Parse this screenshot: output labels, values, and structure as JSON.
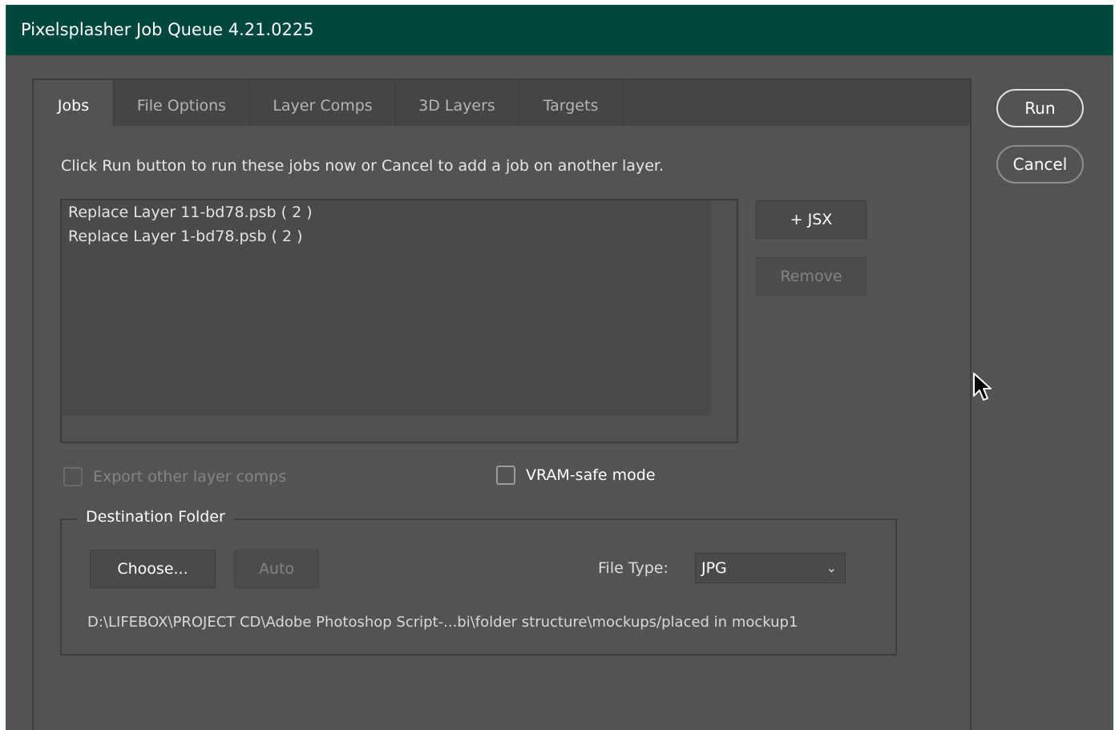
{
  "window": {
    "title": "Pixelsplasher Job Queue 4.21.0225"
  },
  "tabs": [
    {
      "label": "Jobs",
      "active": true
    },
    {
      "label": "File Options",
      "active": false
    },
    {
      "label": "Layer Comps",
      "active": false
    },
    {
      "label": "3D Layers",
      "active": false
    },
    {
      "label": "Targets",
      "active": false
    }
  ],
  "jobs": {
    "instructions": "Click Run button to run these jobs now or Cancel to add a job on another layer.",
    "items": [
      "Replace Layer 11-bd78.psb ( 2 )",
      "Replace Layer 1-bd78.psb ( 2 )"
    ],
    "add_jsx_label": "+ JSX",
    "remove_label": "Remove"
  },
  "options": {
    "export_other_comps_label": "Export other layer comps",
    "export_other_comps_checked": false,
    "export_other_comps_enabled": false,
    "vram_safe_label": "VRAM-safe mode",
    "vram_safe_checked": false
  },
  "destination": {
    "legend": "Destination Folder",
    "choose_label": "Choose...",
    "auto_label": "Auto",
    "file_type_label": "File Type:",
    "file_type_value": "JPG",
    "path": "D:\\LIFEBOX\\PROJECT CD\\Adobe Photoshop Script-...bi\\folder structure\\mockups/placed in mockup1"
  },
  "actions": {
    "run_label": "Run",
    "cancel_label": "Cancel"
  },
  "colors": {
    "titlebar": "#00483d",
    "dialog_bg": "#535353",
    "tabbar_bg": "#454545"
  }
}
